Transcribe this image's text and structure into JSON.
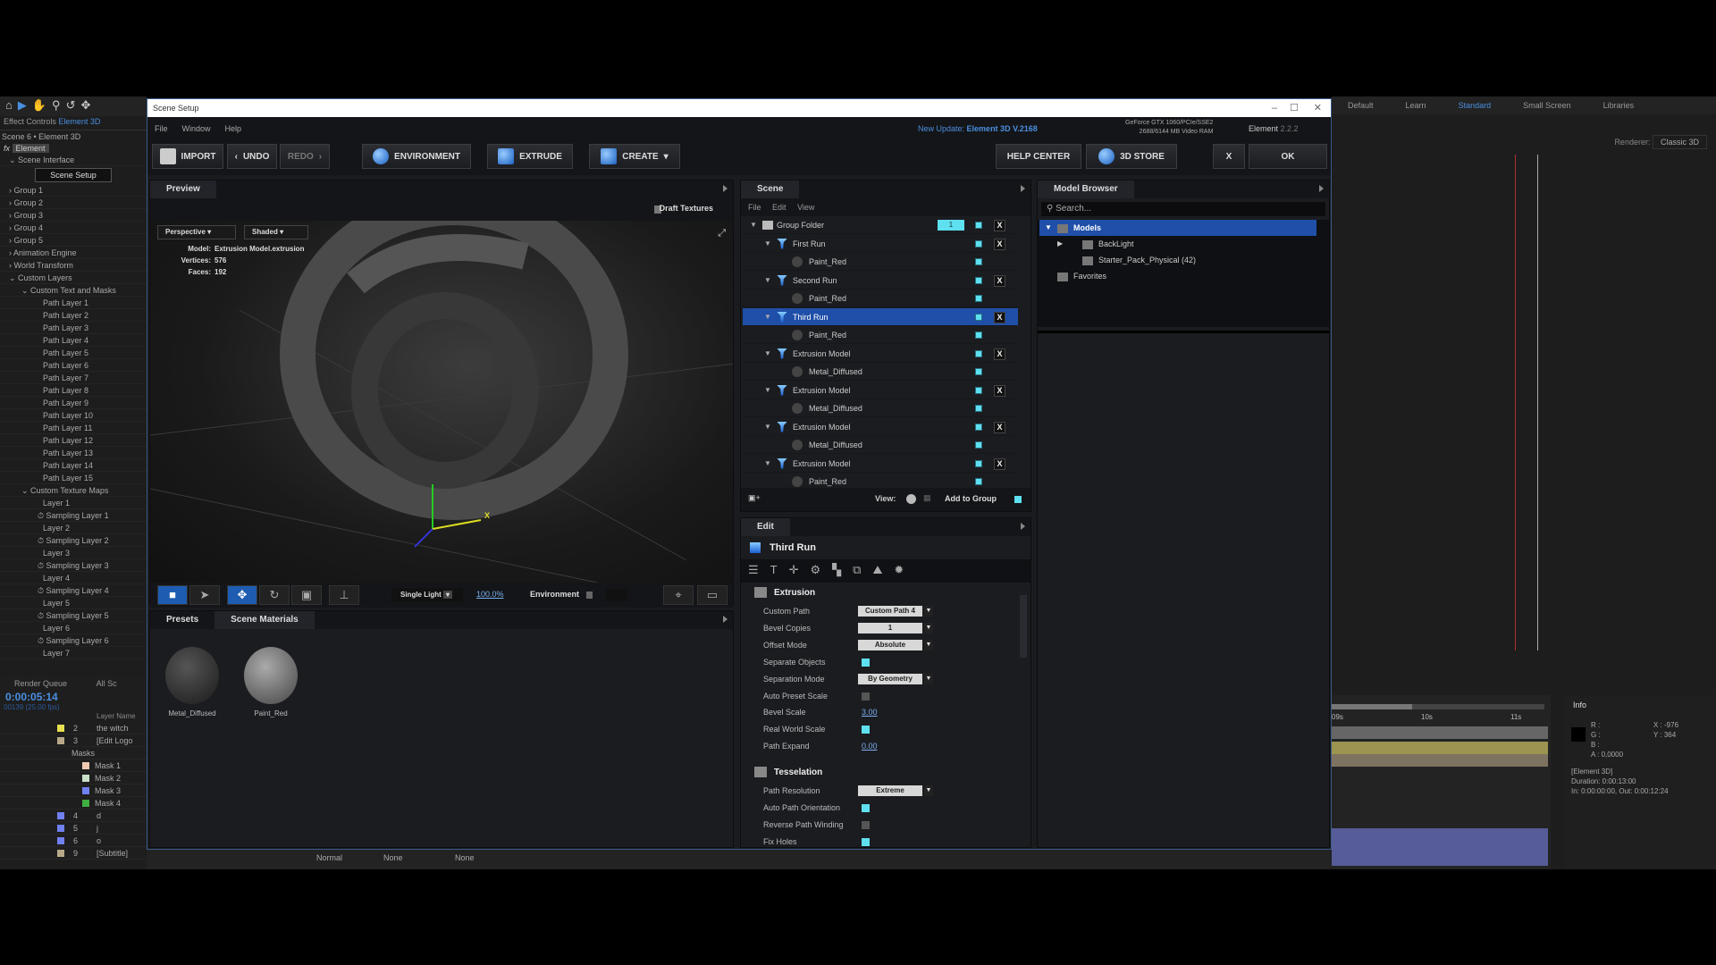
{
  "ae": {
    "effect_controls_label": "Effect Controls",
    "effect_controls_target": "Element 3D",
    "comp_label": "Scene 6 • Element 3D",
    "fx_label": "Element",
    "tree": [
      {
        "label": "Scene Interface",
        "indent": 1,
        "open": true
      },
      {
        "label": "Group 1",
        "indent": 1
      },
      {
        "label": "Group 2",
        "indent": 1
      },
      {
        "label": "Group 3",
        "indent": 1
      },
      {
        "label": "Group 4",
        "indent": 1
      },
      {
        "label": "Group 5",
        "indent": 1
      },
      {
        "label": "Animation Engine",
        "indent": 1
      },
      {
        "label": "World Transform",
        "indent": 1
      },
      {
        "label": "Custom Layers",
        "indent": 1,
        "open": true
      },
      {
        "label": "Custom Text and Masks",
        "indent": 2,
        "open": true
      },
      {
        "label": "Path Layer 1",
        "indent": 3
      },
      {
        "label": "Path Layer 2",
        "indent": 3
      },
      {
        "label": "Path Layer 3",
        "indent": 3
      },
      {
        "label": "Path Layer 4",
        "indent": 3
      },
      {
        "label": "Path Layer 5",
        "indent": 3
      },
      {
        "label": "Path Layer 6",
        "indent": 3
      },
      {
        "label": "Path Layer 7",
        "indent": 3
      },
      {
        "label": "Path Layer 8",
        "indent": 3
      },
      {
        "label": "Path Layer 9",
        "indent": 3
      },
      {
        "label": "Path Layer 10",
        "indent": 3
      },
      {
        "label": "Path Layer 11",
        "indent": 3
      },
      {
        "label": "Path Layer 12",
        "indent": 3
      },
      {
        "label": "Path Layer 13",
        "indent": 3
      },
      {
        "label": "Path Layer 14",
        "indent": 3
      },
      {
        "label": "Path Layer 15",
        "indent": 3
      },
      {
        "label": "Custom Texture Maps",
        "indent": 2,
        "open": true
      },
      {
        "label": "Layer 1",
        "indent": 3
      },
      {
        "label": "Sampling Layer 1",
        "indent": 3,
        "stopwatch": true
      },
      {
        "label": "Layer 2",
        "indent": 3
      },
      {
        "label": "Sampling Layer 2",
        "indent": 3,
        "stopwatch": true
      },
      {
        "label": "Layer 3",
        "indent": 3
      },
      {
        "label": "Sampling Layer 3",
        "indent": 3,
        "stopwatch": true
      },
      {
        "label": "Layer 4",
        "indent": 3
      },
      {
        "label": "Sampling Layer 4",
        "indent": 3,
        "stopwatch": true
      },
      {
        "label": "Layer 5",
        "indent": 3
      },
      {
        "label": "Sampling Layer 5",
        "indent": 3,
        "stopwatch": true
      },
      {
        "label": "Layer 6",
        "indent": 3
      },
      {
        "label": "Sampling Layer 6",
        "indent": 3,
        "stopwatch": true
      },
      {
        "label": "Layer 7",
        "indent": 3
      }
    ],
    "scene_setup_button": "Scene Setup",
    "render_queue": "Render Queue",
    "all_scenes": "All Sc",
    "timecode": "0:00:05:14",
    "frame_info": "00139 (25.00 fps)",
    "layer_name_header": "Layer Name",
    "layers": [
      {
        "num": "2",
        "name": "the witch",
        "color": "#e8e050",
        "type": "T"
      },
      {
        "num": "3",
        "name": "[Edit Logo",
        "color": "#b8a888",
        "type": "img",
        "open": true
      },
      {
        "num": "",
        "name": "Masks",
        "color": "",
        "type": "group"
      },
      {
        "num": "",
        "name": "Mask 1",
        "color": "#f0c8b0",
        "type": "mask"
      },
      {
        "num": "",
        "name": "Mask 2",
        "color": "#c8e0c8",
        "type": "mask"
      },
      {
        "num": "",
        "name": "Mask 3",
        "color": "#7080f0",
        "type": "mask"
      },
      {
        "num": "",
        "name": "Mask 4",
        "color": "#40b040",
        "type": "mask"
      },
      {
        "num": "4",
        "name": "d",
        "color": "#7080f0",
        "type": "T"
      },
      {
        "num": "5",
        "name": "j",
        "color": "#7080f0",
        "type": "T"
      },
      {
        "num": "6",
        "name": "o",
        "color": "#7080f0",
        "type": "T"
      },
      {
        "num": "9",
        "name": "[Subtitle]",
        "color": "#b8a888",
        "type": "img"
      }
    ],
    "bottom_modes": [
      "Normal",
      "None",
      "None"
    ],
    "workspaces": [
      "Default",
      "Learn",
      "Standard",
      "Small Screen",
      "Libraries"
    ],
    "active_workspace": "Standard",
    "renderer_label": "Renderer:",
    "renderer_value": "Classic 3D",
    "ruler": [
      "09s",
      "10s",
      "11s"
    ],
    "info": {
      "title": "Info",
      "r": "R :",
      "g": "G :",
      "b": "B :",
      "a": "A :  0,0000",
      "x": "X : -976",
      "y": "Y : 364",
      "layer": "[Element 3D]",
      "duration": "Duration: 0:00:13:00",
      "inout": "In: 0:00:00:00, Out: 0:00:12:24"
    }
  },
  "dialog": {
    "title": "Scene Setup",
    "menu": [
      "File",
      "Window",
      "Help"
    ],
    "update_prefix": "New Update:",
    "update_version": "Element 3D V.2168",
    "gpu_line1": "GeForce GTX 1060/PCIe/SSE2",
    "gpu_line2": "2688/6144 MB Video RAM",
    "product": "Element",
    "product_version": "2.2.2",
    "toolbar": {
      "import": "IMPORT",
      "undo": "UNDO",
      "redo": "REDO",
      "environment": "ENVIRONMENT",
      "extrude": "EXTRUDE",
      "create": "CREATE",
      "help": "HELP CENTER",
      "store": "3D STORE",
      "close": "X",
      "ok": "OK"
    },
    "preview": {
      "tab": "Preview",
      "draft_textures": "Draft Textures",
      "camera": "Perspective",
      "shading": "Shaded",
      "model_label": "Model:",
      "model_value": "Extrusion Model.extrusion",
      "vertices_label": "Vertices:",
      "vertices_value": "576",
      "faces_label": "Faces:",
      "faces_value": "192",
      "axis_x": "X",
      "light": "Single Light",
      "light_pct": "100.0%",
      "environment": "Environment"
    },
    "materials": {
      "tabs": [
        "Presets",
        "Scene Materials"
      ],
      "active_tab": "Scene Materials",
      "items": [
        "Metal_Diffused",
        "Paint_Red"
      ]
    },
    "scene": {
      "tab": "Scene",
      "menu": [
        "File",
        "Edit",
        "View"
      ],
      "group_count": "1",
      "rows": [
        {
          "label": "Group Folder",
          "kind": "folder",
          "x": true
        },
        {
          "label": "First Run",
          "kind": "model",
          "x": true
        },
        {
          "label": "Paint_Red",
          "kind": "material"
        },
        {
          "label": "Second Run",
          "kind": "model",
          "x": true
        },
        {
          "label": "Paint_Red",
          "kind": "material"
        },
        {
          "label": "Third Run",
          "kind": "model",
          "x": true,
          "selected": true
        },
        {
          "label": "Paint_Red",
          "kind": "material"
        },
        {
          "label": "Extrusion Model",
          "kind": "model",
          "x": true
        },
        {
          "label": "Metal_Diffused",
          "kind": "material"
        },
        {
          "label": "Extrusion Model",
          "kind": "model",
          "x": true
        },
        {
          "label": "Metal_Diffused",
          "kind": "material"
        },
        {
          "label": "Extrusion Model",
          "kind": "model",
          "x": true
        },
        {
          "label": "Metal_Diffused",
          "kind": "material"
        },
        {
          "label": "Extrusion Model",
          "kind": "model",
          "x": true
        },
        {
          "label": "Paint_Red",
          "kind": "material"
        }
      ],
      "view_label": "View:",
      "add_to_group": "Add to Group"
    },
    "edit": {
      "tab": "Edit",
      "object": "Third Run",
      "sections": [
        {
          "title": "Extrusion",
          "rows": [
            {
              "label": "Custom Path",
              "type": "select",
              "value": "Custom Path 4"
            },
            {
              "label": "Bevel Copies",
              "type": "select",
              "value": "1"
            },
            {
              "label": "Offset Mode",
              "type": "select",
              "value": "Absolute"
            },
            {
              "label": "Separate Objects",
              "type": "check",
              "value": true
            },
            {
              "label": "Separation Mode",
              "type": "select",
              "value": "By Geometry"
            },
            {
              "label": "Auto Preset Scale",
              "type": "check",
              "value": false
            },
            {
              "label": "Bevel Scale",
              "type": "num",
              "value": "3.00"
            },
            {
              "label": "Real World Scale",
              "type": "check",
              "value": true
            },
            {
              "label": "Path Expand",
              "type": "num",
              "value": "0.00"
            }
          ]
        },
        {
          "title": "Tesselation",
          "rows": [
            {
              "label": "Path Resolution",
              "type": "select",
              "value": "Extreme"
            },
            {
              "label": "Auto Path Orientation",
              "type": "check",
              "value": true
            },
            {
              "label": "Reverse Path Winding",
              "type": "check",
              "value": false
            },
            {
              "label": "Fix Holes",
              "type": "check",
              "value": true
            }
          ]
        }
      ]
    },
    "browser": {
      "tab": "Model Browser",
      "search_placeholder": "Search...",
      "items": [
        {
          "label": "Models",
          "level": 0,
          "selected": true,
          "open": true
        },
        {
          "label": "BackLight",
          "level": 1,
          "collapsed": true
        },
        {
          "label": "Starter_Pack_Physical (42)",
          "level": 1
        },
        {
          "label": "Favorites",
          "level": 0
        }
      ]
    }
  },
  "colors": {
    "accent": "#1f4fa8",
    "cyan": "#5ee0f0",
    "link": "#4a8fe0"
  }
}
